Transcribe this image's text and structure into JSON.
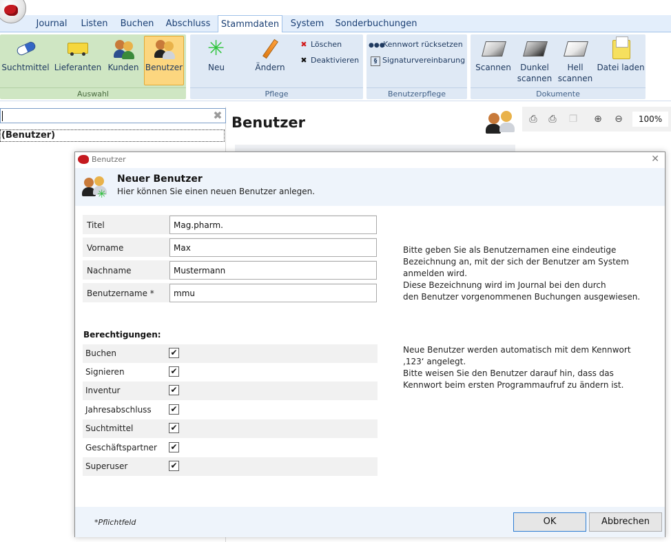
{
  "app": {
    "logo_icon": "app-logo-icon"
  },
  "tabs": [
    {
      "label": "Journal"
    },
    {
      "label": "Listen"
    },
    {
      "label": "Buchen"
    },
    {
      "label": "Abschluss"
    },
    {
      "label": "Stammdaten",
      "active": true
    },
    {
      "label": "System"
    },
    {
      "label": "Sonderbuchungen"
    }
  ],
  "ribbon": {
    "auswahl": {
      "title": "Auswahl",
      "suchtmittel": "Suchtmittel",
      "lieferanten": "Lieferanten",
      "kunden": "Kunden",
      "benutzer": "Benutzer"
    },
    "pflege": {
      "title": "Pflege",
      "neu": "Neu",
      "aendern": "Ändern",
      "loeschen": "Löschen",
      "deaktivieren": "Deaktivieren"
    },
    "benutzerpflege": {
      "title": "Benutzerpflege",
      "kennwort": "Kennwort rücksetzen",
      "signatur": "Signaturvereinbarung"
    },
    "dokumente": {
      "title": "Dokumente",
      "scannen": "Scannen",
      "dunkel1": "Dunkel",
      "dunkel2": "scannen",
      "hell1": "Hell",
      "hell2": "scannen",
      "datei": "Datei laden"
    }
  },
  "left": {
    "search_value": "",
    "tree_item": "(Benutzer)"
  },
  "content": {
    "title": "Benutzer",
    "zoom": "100%"
  },
  "dialog": {
    "window_title": "Benutzer",
    "header_title": "Neuer Benutzer",
    "header_sub": "Hier können Sie einen neuen Benutzer anlegen.",
    "fields": {
      "titel": {
        "label": "Titel",
        "value": "Mag.pharm."
      },
      "vorname": {
        "label": "Vorname",
        "value": "Max"
      },
      "nachname": {
        "label": "Nachname",
        "value": "Mustermann"
      },
      "benutzername": {
        "label": "Benutzername *",
        "value": "mmu"
      }
    },
    "permissions_heading": "Berechtigungen:",
    "permissions": [
      {
        "label": "Buchen",
        "checked": true
      },
      {
        "label": "Signieren",
        "checked": true
      },
      {
        "label": "Inventur",
        "checked": true
      },
      {
        "label": "Jahresabschluss",
        "checked": true
      },
      {
        "label": "Suchtmittel",
        "checked": true
      },
      {
        "label": "Geschäftspartner",
        "checked": true
      },
      {
        "label": "Superuser",
        "checked": true
      }
    ],
    "info1": [
      "Bitte geben Sie als Benutzernamen eine eindeutige",
      "Bezeichnung an, mit der sich der Benutzer am System",
      "anmelden wird.",
      "Diese Bezeichnung wird im Journal bei den durch",
      "den Benutzer vorgenommenen Buchungen ausgewiesen."
    ],
    "info2": [
      "Neue Benutzer werden automatisch mit dem Kennwort",
      "‚123‘ angelegt.",
      "Bitte weisen Sie den Benutzer darauf hin, dass das",
      "Kennwort beim ersten Programmaufruf zu ändern ist."
    ],
    "required_note": "*Pflichtfeld",
    "ok": "OK",
    "cancel": "Abbrechen"
  },
  "colors": {
    "ribbon_group": "#dfe9f5",
    "ribbon_group_selection": "#cfe6c3",
    "selected_button": "#fcd67f",
    "dialog_header": "#eef4fb",
    "ok_border": "#2b7cd3"
  }
}
